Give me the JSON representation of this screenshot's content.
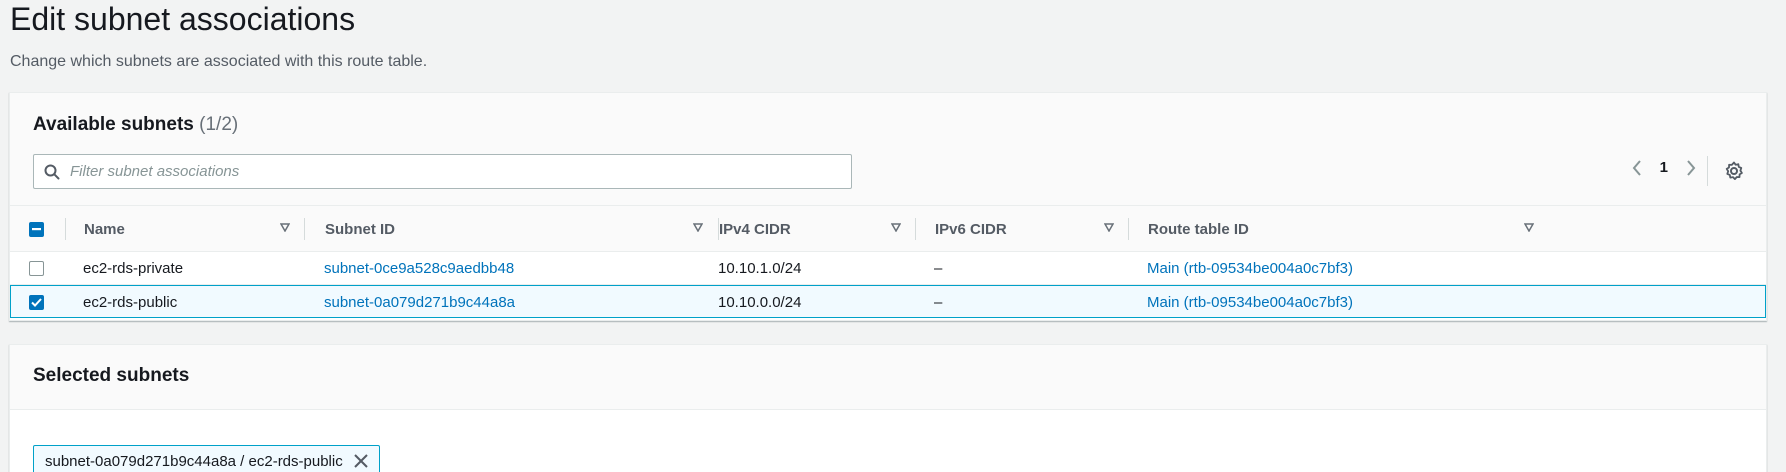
{
  "page": {
    "title": "Edit subnet associations",
    "description": "Change which subnets are associated with this route table."
  },
  "available": {
    "title": "Available subnets",
    "count": "(1/2)",
    "filter_placeholder": "Filter subnet associations",
    "page_number": "1",
    "columns": [
      "Name",
      "Subnet ID",
      "IPv4 CIDR",
      "IPv6 CIDR",
      "Route table ID"
    ],
    "rows": [
      {
        "checked": false,
        "name": "ec2-rds-private",
        "subnet_id": "subnet-0ce9a528c9aedbb48",
        "ipv4": "10.10.1.0/24",
        "ipv6": "–",
        "route_table": "Main (rtb-09534be004a0c7bf3)"
      },
      {
        "checked": true,
        "name": "ec2-rds-public",
        "subnet_id": "subnet-0a079d271b9c44a8a",
        "ipv4": "10.10.0.0/24",
        "ipv6": "–",
        "route_table": "Main (rtb-09534be004a0c7bf3)"
      }
    ]
  },
  "selected": {
    "title": "Selected subnets",
    "tokens": [
      "subnet-0a079d271b9c44a8a / ec2-rds-public"
    ]
  },
  "colors": {
    "link": "#0073bb",
    "selected_border": "#00a1c9",
    "selected_bg": "#f1faff"
  }
}
